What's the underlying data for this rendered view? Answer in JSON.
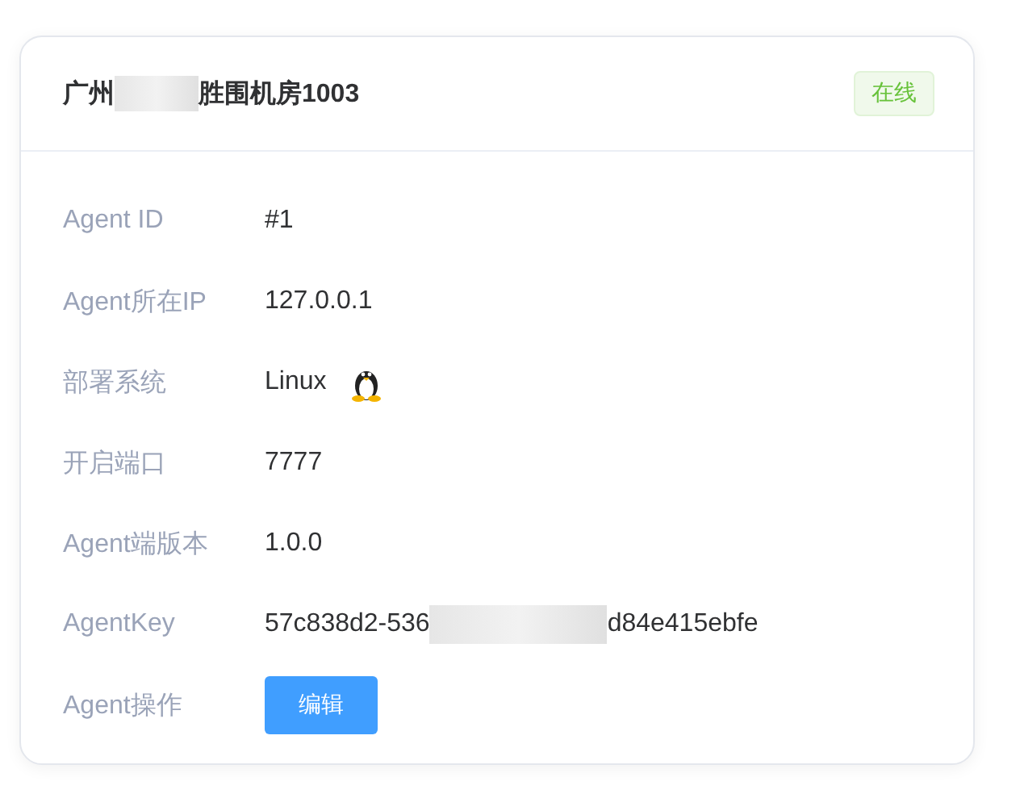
{
  "card": {
    "title": [
      {
        "kind": "text",
        "text": "广州"
      },
      {
        "kind": "redacted"
      },
      {
        "kind": "text",
        "text": "胜围机房1003"
      }
    ],
    "status": {
      "label": "在线",
      "kind": "online"
    },
    "rows": [
      {
        "label": "Agent ID",
        "kind": "text",
        "value": [
          {
            "kind": "text",
            "text": "#1"
          }
        ]
      },
      {
        "label": "Agent所在IP",
        "kind": "text",
        "value": [
          {
            "kind": "text",
            "text": "127.0.0.1"
          }
        ]
      },
      {
        "label": "部署系统",
        "kind": "os",
        "value": [
          {
            "kind": "text",
            "text": "Linux"
          }
        ]
      },
      {
        "label": "开启端口",
        "kind": "text",
        "value": [
          {
            "kind": "text",
            "text": "7777"
          }
        ]
      },
      {
        "label": "Agent端版本",
        "kind": "text",
        "value": [
          {
            "kind": "text",
            "text": "1.0.0"
          }
        ]
      },
      {
        "label": "AgentKey",
        "kind": "text",
        "value": [
          {
            "kind": "text",
            "text": "57c838d2-536"
          },
          {
            "kind": "redacted"
          },
          {
            "kind": "text",
            "text": "d84e415ebfe"
          }
        ]
      },
      {
        "label": "Agent操作",
        "kind": "button",
        "value": [
          {
            "kind": "text",
            "text": "编辑"
          }
        ]
      }
    ]
  }
}
